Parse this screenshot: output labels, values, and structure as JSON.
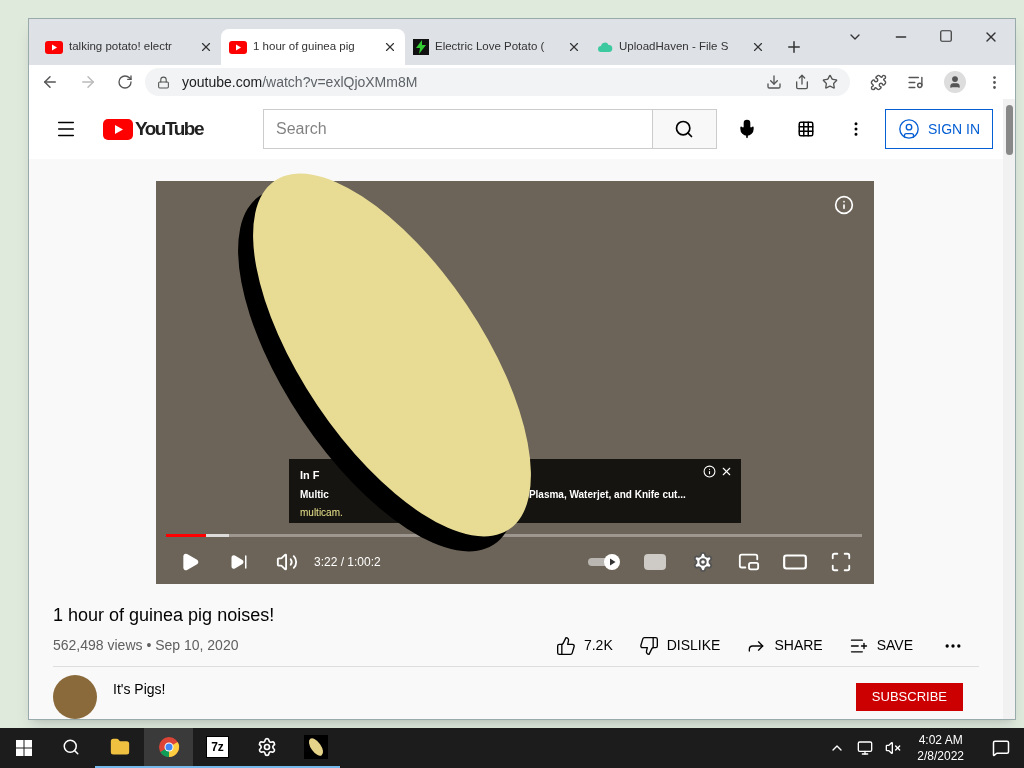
{
  "browser": {
    "tabs": [
      {
        "title": "talking potato! electr",
        "selected": false
      },
      {
        "title": "1 hour of guinea pig",
        "selected": true
      },
      {
        "title": "Electric Love Potato (",
        "selected": false
      },
      {
        "title": "UploadHaven - File S",
        "selected": false
      }
    ],
    "url_host": "youtube.com",
    "url_path": "/watch?v=exlQjoXMm8M"
  },
  "youtube": {
    "logo_text": "YouTube",
    "search": {
      "placeholder": "Search"
    },
    "sign_in": "SIGN IN",
    "player": {
      "progress": {
        "level": 0.058
      },
      "buffer": {
        "level": 0.09
      },
      "time": "3:22 / 1:00:2",
      "ad": {
        "title": "In F",
        "line": "Multic",
        "line_rest": "Plasma, Waterjet, and Knife cut...",
        "domain": "multicam."
      }
    },
    "video_title": "1 hour of guinea pig noises!",
    "views": "562,498 views • Sep 10, 2020",
    "actions": [
      {
        "kind": "like",
        "label": "7.2K"
      },
      {
        "kind": "dislike",
        "label": "DISLIKE"
      },
      {
        "kind": "share",
        "label": "SHARE"
      },
      {
        "kind": "save",
        "label": "SAVE"
      }
    ],
    "channel": "It's Pigs!",
    "subscribe": "SUBSCRIBE"
  },
  "taskbar": {
    "apps": [
      {
        "kind": "search",
        "selected": false
      },
      {
        "kind": "folder",
        "selected": true
      },
      {
        "kind": "chrome",
        "selected": true
      },
      {
        "kind": "sevenzip",
        "label": "7z",
        "selected": true
      },
      {
        "kind": "settings",
        "selected": true
      },
      {
        "kind": "potato",
        "selected": true
      }
    ],
    "time": "4:02 AM",
    "date": "2/8/2022"
  }
}
